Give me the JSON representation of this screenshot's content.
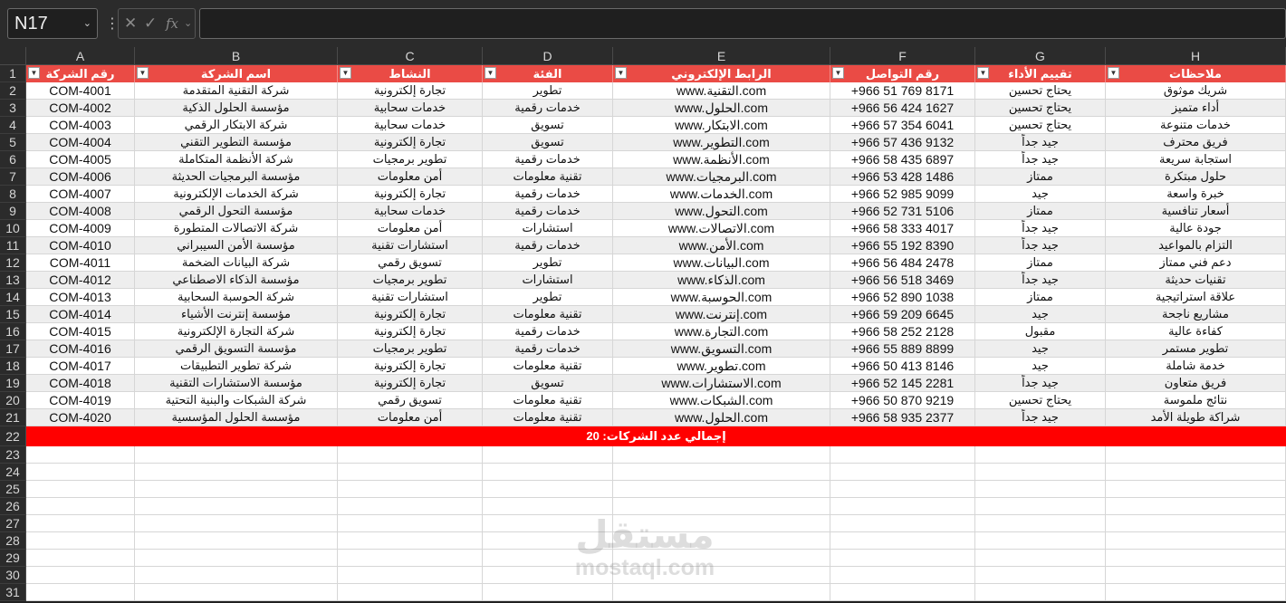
{
  "namebox": {
    "value": "N17"
  },
  "formula": {
    "value": ""
  },
  "columns": [
    "A",
    "B",
    "C",
    "D",
    "E",
    "F",
    "G",
    "H"
  ],
  "headers": [
    "رقم الشركة",
    "اسم الشركة",
    "النشاط",
    "الفئة",
    "الرابط الإلكتروني",
    "رقم التواصل",
    "تقييم الأداء",
    "ملاحظات"
  ],
  "rows": [
    [
      "COM-4001",
      "شركة التقنية المتقدمة",
      "تجارة إلكترونية",
      "تطوير",
      "www.التقنية.com",
      "+966 51 769 8171",
      "يحتاج تحسين",
      "شريك موثوق"
    ],
    [
      "COM-4002",
      "مؤسسة الحلول الذكية",
      "خدمات سحابية",
      "خدمات رقمية",
      "www.الحلول.com",
      "+966 56 424 1627",
      "يحتاج تحسين",
      "أداء متميز"
    ],
    [
      "COM-4003",
      "شركة الابتكار الرقمي",
      "خدمات سحابية",
      "تسويق",
      "www.الابتكار.com",
      "+966 57 354 6041",
      "يحتاج تحسين",
      "خدمات متنوعة"
    ],
    [
      "COM-4004",
      "مؤسسة التطوير التقني",
      "تجارة إلكترونية",
      "تسويق",
      "www.التطوير.com",
      "+966 57 436 9132",
      "جيد جداً",
      "فريق محترف"
    ],
    [
      "COM-4005",
      "شركة الأنظمة المتكاملة",
      "تطوير برمجيات",
      "خدمات رقمية",
      "www.الأنظمة.com",
      "+966 58 435 6897",
      "جيد جداً",
      "استجابة سريعة"
    ],
    [
      "COM-4006",
      "مؤسسة البرمجيات الحديثة",
      "أمن معلومات",
      "تقنية معلومات",
      "www.البرمجيات.com",
      "+966 53 428 1486",
      "ممتاز",
      "حلول مبتكرة"
    ],
    [
      "COM-4007",
      "شركة الخدمات الإلكترونية",
      "تجارة إلكترونية",
      "خدمات رقمية",
      "www.الخدمات.com",
      "+966 52 985 9099",
      "جيد",
      "خبرة واسعة"
    ],
    [
      "COM-4008",
      "مؤسسة التحول الرقمي",
      "خدمات سحابية",
      "خدمات رقمية",
      "www.التحول.com",
      "+966 52 731 5106",
      "ممتاز",
      "أسعار تنافسية"
    ],
    [
      "COM-4009",
      "شركة الاتصالات المتطورة",
      "أمن معلومات",
      "استشارات",
      "www.الاتصالات.com",
      "+966 58 333 4017",
      "جيد جداً",
      "جودة عالية"
    ],
    [
      "COM-4010",
      "مؤسسة الأمن السيبراني",
      "استشارات تقنية",
      "خدمات رقمية",
      "www.الأمن.com",
      "+966 55 192 8390",
      "جيد جداً",
      "التزام بالمواعيد"
    ],
    [
      "COM-4011",
      "شركة البيانات الضخمة",
      "تسويق رقمي",
      "تطوير",
      "www.البيانات.com",
      "+966 56 484 2478",
      "ممتاز",
      "دعم فني ممتاز"
    ],
    [
      "COM-4012",
      "مؤسسة الذكاء الاصطناعي",
      "تطوير برمجيات",
      "استشارات",
      "www.الذكاء.com",
      "+966 56 518 3469",
      "جيد جداً",
      "تقنيات حديثة"
    ],
    [
      "COM-4013",
      "شركة الحوسبة السحابية",
      "استشارات تقنية",
      "تطوير",
      "www.الحوسبة.com",
      "+966 52 890 1038",
      "ممتاز",
      "علاقة استراتيجية"
    ],
    [
      "COM-4014",
      "مؤسسة إنترنت الأشياء",
      "تجارة إلكترونية",
      "تقنية معلومات",
      "www.إنترنت.com",
      "+966 59 209 6645",
      "جيد",
      "مشاريع ناجحة"
    ],
    [
      "COM-4015",
      "شركة التجارة الإلكترونية",
      "تجارة إلكترونية",
      "خدمات رقمية",
      "www.التجارة.com",
      "+966 58 252 2128",
      "مقبول",
      "كفاءة عالية"
    ],
    [
      "COM-4016",
      "مؤسسة التسويق الرقمي",
      "تطوير برمجيات",
      "خدمات رقمية",
      "www.التسويق.com",
      "+966 55 889 8899",
      "جيد",
      "تطوير مستمر"
    ],
    [
      "COM-4017",
      "شركة تطوير التطبيقات",
      "تجارة إلكترونية",
      "تقنية معلومات",
      "www.تطوير.com",
      "+966 50 413 8146",
      "جيد",
      "خدمة شاملة"
    ],
    [
      "COM-4018",
      "مؤسسة الاستشارات التقنية",
      "تجارة إلكترونية",
      "تسويق",
      "www.الاستشارات.com",
      "+966 52 145 2281",
      "جيد جداً",
      "فريق متعاون"
    ],
    [
      "COM-4019",
      "شركة الشبكات والبنية التحتية",
      "تسويق رقمي",
      "تقنية معلومات",
      "www.الشبكات.com",
      "+966 50 870 9219",
      "يحتاج تحسين",
      "نتائج ملموسة"
    ],
    [
      "COM-4020",
      "مؤسسة الحلول المؤسسية",
      "أمن معلومات",
      "تقنية معلومات",
      "www.الحلول.com",
      "+966 58 935 2377",
      "جيد جداً",
      "شراكة طويلة الأمد"
    ]
  ],
  "total": {
    "label": "إجمالي عدد الشركات: 20"
  },
  "row_numbers": [
    "1",
    "2",
    "3",
    "4",
    "5",
    "6",
    "7",
    "8",
    "9",
    "10",
    "11",
    "12",
    "13",
    "14",
    "15",
    "16",
    "17",
    "18",
    "19",
    "20",
    "21",
    "22",
    "23",
    "24",
    "25",
    "26",
    "27",
    "28",
    "29",
    "30",
    "31"
  ],
  "watermark": {
    "arabic": "مستقل",
    "latin": "mostaql.com"
  },
  "colors": {
    "header_fill": "#ea4b45",
    "total_fill": "#ff0000",
    "band_fill": "#eeeeee"
  }
}
